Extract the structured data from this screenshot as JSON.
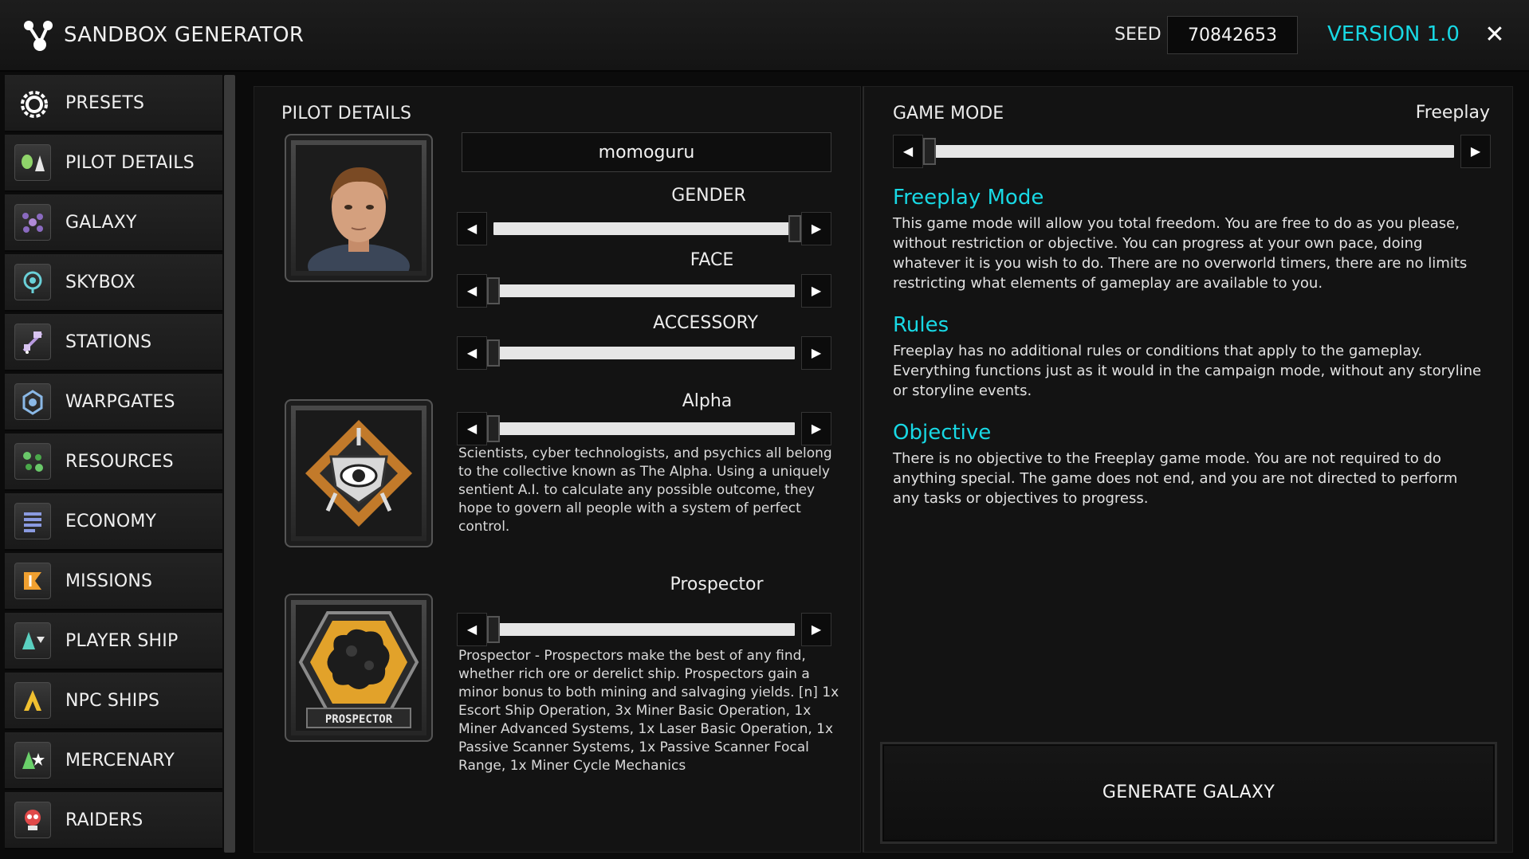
{
  "header": {
    "title": "SANDBOX GENERATOR",
    "seed_label": "SEED",
    "seed_value": "70842653",
    "version": "VERSION 1.0",
    "close_icon": "close-icon"
  },
  "sidebar": {
    "items": [
      {
        "label": "PRESETS",
        "icon": "gear-icon"
      },
      {
        "label": "PILOT DETAILS",
        "icon": "pilot-icon"
      },
      {
        "label": "GALAXY",
        "icon": "galaxy-icon"
      },
      {
        "label": "SKYBOX",
        "icon": "skybox-icon"
      },
      {
        "label": "STATIONS",
        "icon": "station-icon"
      },
      {
        "label": "WARPGATES",
        "icon": "warpgate-icon"
      },
      {
        "label": "RESOURCES",
        "icon": "resources-icon"
      },
      {
        "label": "ECONOMY",
        "icon": "economy-icon"
      },
      {
        "label": "MISSIONS",
        "icon": "missions-icon"
      },
      {
        "label": "PLAYER SHIP",
        "icon": "player-ship-icon"
      },
      {
        "label": "NPC SHIPS",
        "icon": "npc-ships-icon"
      },
      {
        "label": "MERCENARY",
        "icon": "mercenary-icon"
      },
      {
        "label": "RAIDERS",
        "icon": "raiders-icon"
      }
    ]
  },
  "pilot": {
    "section_title": "PILOT DETAILS",
    "name_value": "momoguru",
    "gender_label": "GENDER",
    "gender_level": 1.0,
    "face_label": "FACE",
    "face_level": 0.0,
    "accessory_label": "ACCESSORY",
    "accessory_level": 0.0,
    "faction_label": "Alpha",
    "faction_level": 0.0,
    "faction_desc": "Scientists, cyber technologists, and psychics all belong to the collective known as The Alpha. Using a uniquely sentient A.I. to calculate any possible outcome, they hope to govern all people with a system of perfect control.",
    "career_label": "Prospector",
    "career_level": 0.0,
    "career_badge_text": "PROSPECTOR",
    "career_desc": "Prospector - Prospectors make the best of any find, whether rich ore or derelict ship. Prospectors gain a minor bonus to both mining and salvaging yields. [n] 1x Escort Ship Operation, 3x Miner Basic Operation, 1x Miner Advanced Systems, 1x Laser Basic Operation, 1x Passive Scanner Systems, 1x Passive Scanner Focal Range, 1x Miner Cycle Mechanics"
  },
  "game_mode": {
    "title": "GAME MODE",
    "value": "Freeplay",
    "level": 0.0,
    "mode_heading": "Freeplay Mode",
    "mode_text": "This game mode will allow you total freedom. You are free to do as you please, without restriction or objective. You can progress at your own pace, doing whatever it is you wish to do. There are no overworld timers, there are no limits restricting what elements of gameplay are available to you.",
    "rules_heading": "Rules",
    "rules_text": "Freeplay has no additional rules or conditions that apply to the gameplay. Everything functions just as it would in the campaign mode, without any storyline or storyline events.",
    "objective_heading": "Objective",
    "objective_text": "There is no objective to the Freeplay game mode. You are not required to do anything special. The game does not end, and you are not directed to perform any tasks or objectives to progress.",
    "generate_label": "GENERATE GALAXY"
  },
  "colors": {
    "accent": "#18d8e4",
    "background": "#0b0b0b",
    "panel": "#131313",
    "track": "#e6e6e6"
  }
}
